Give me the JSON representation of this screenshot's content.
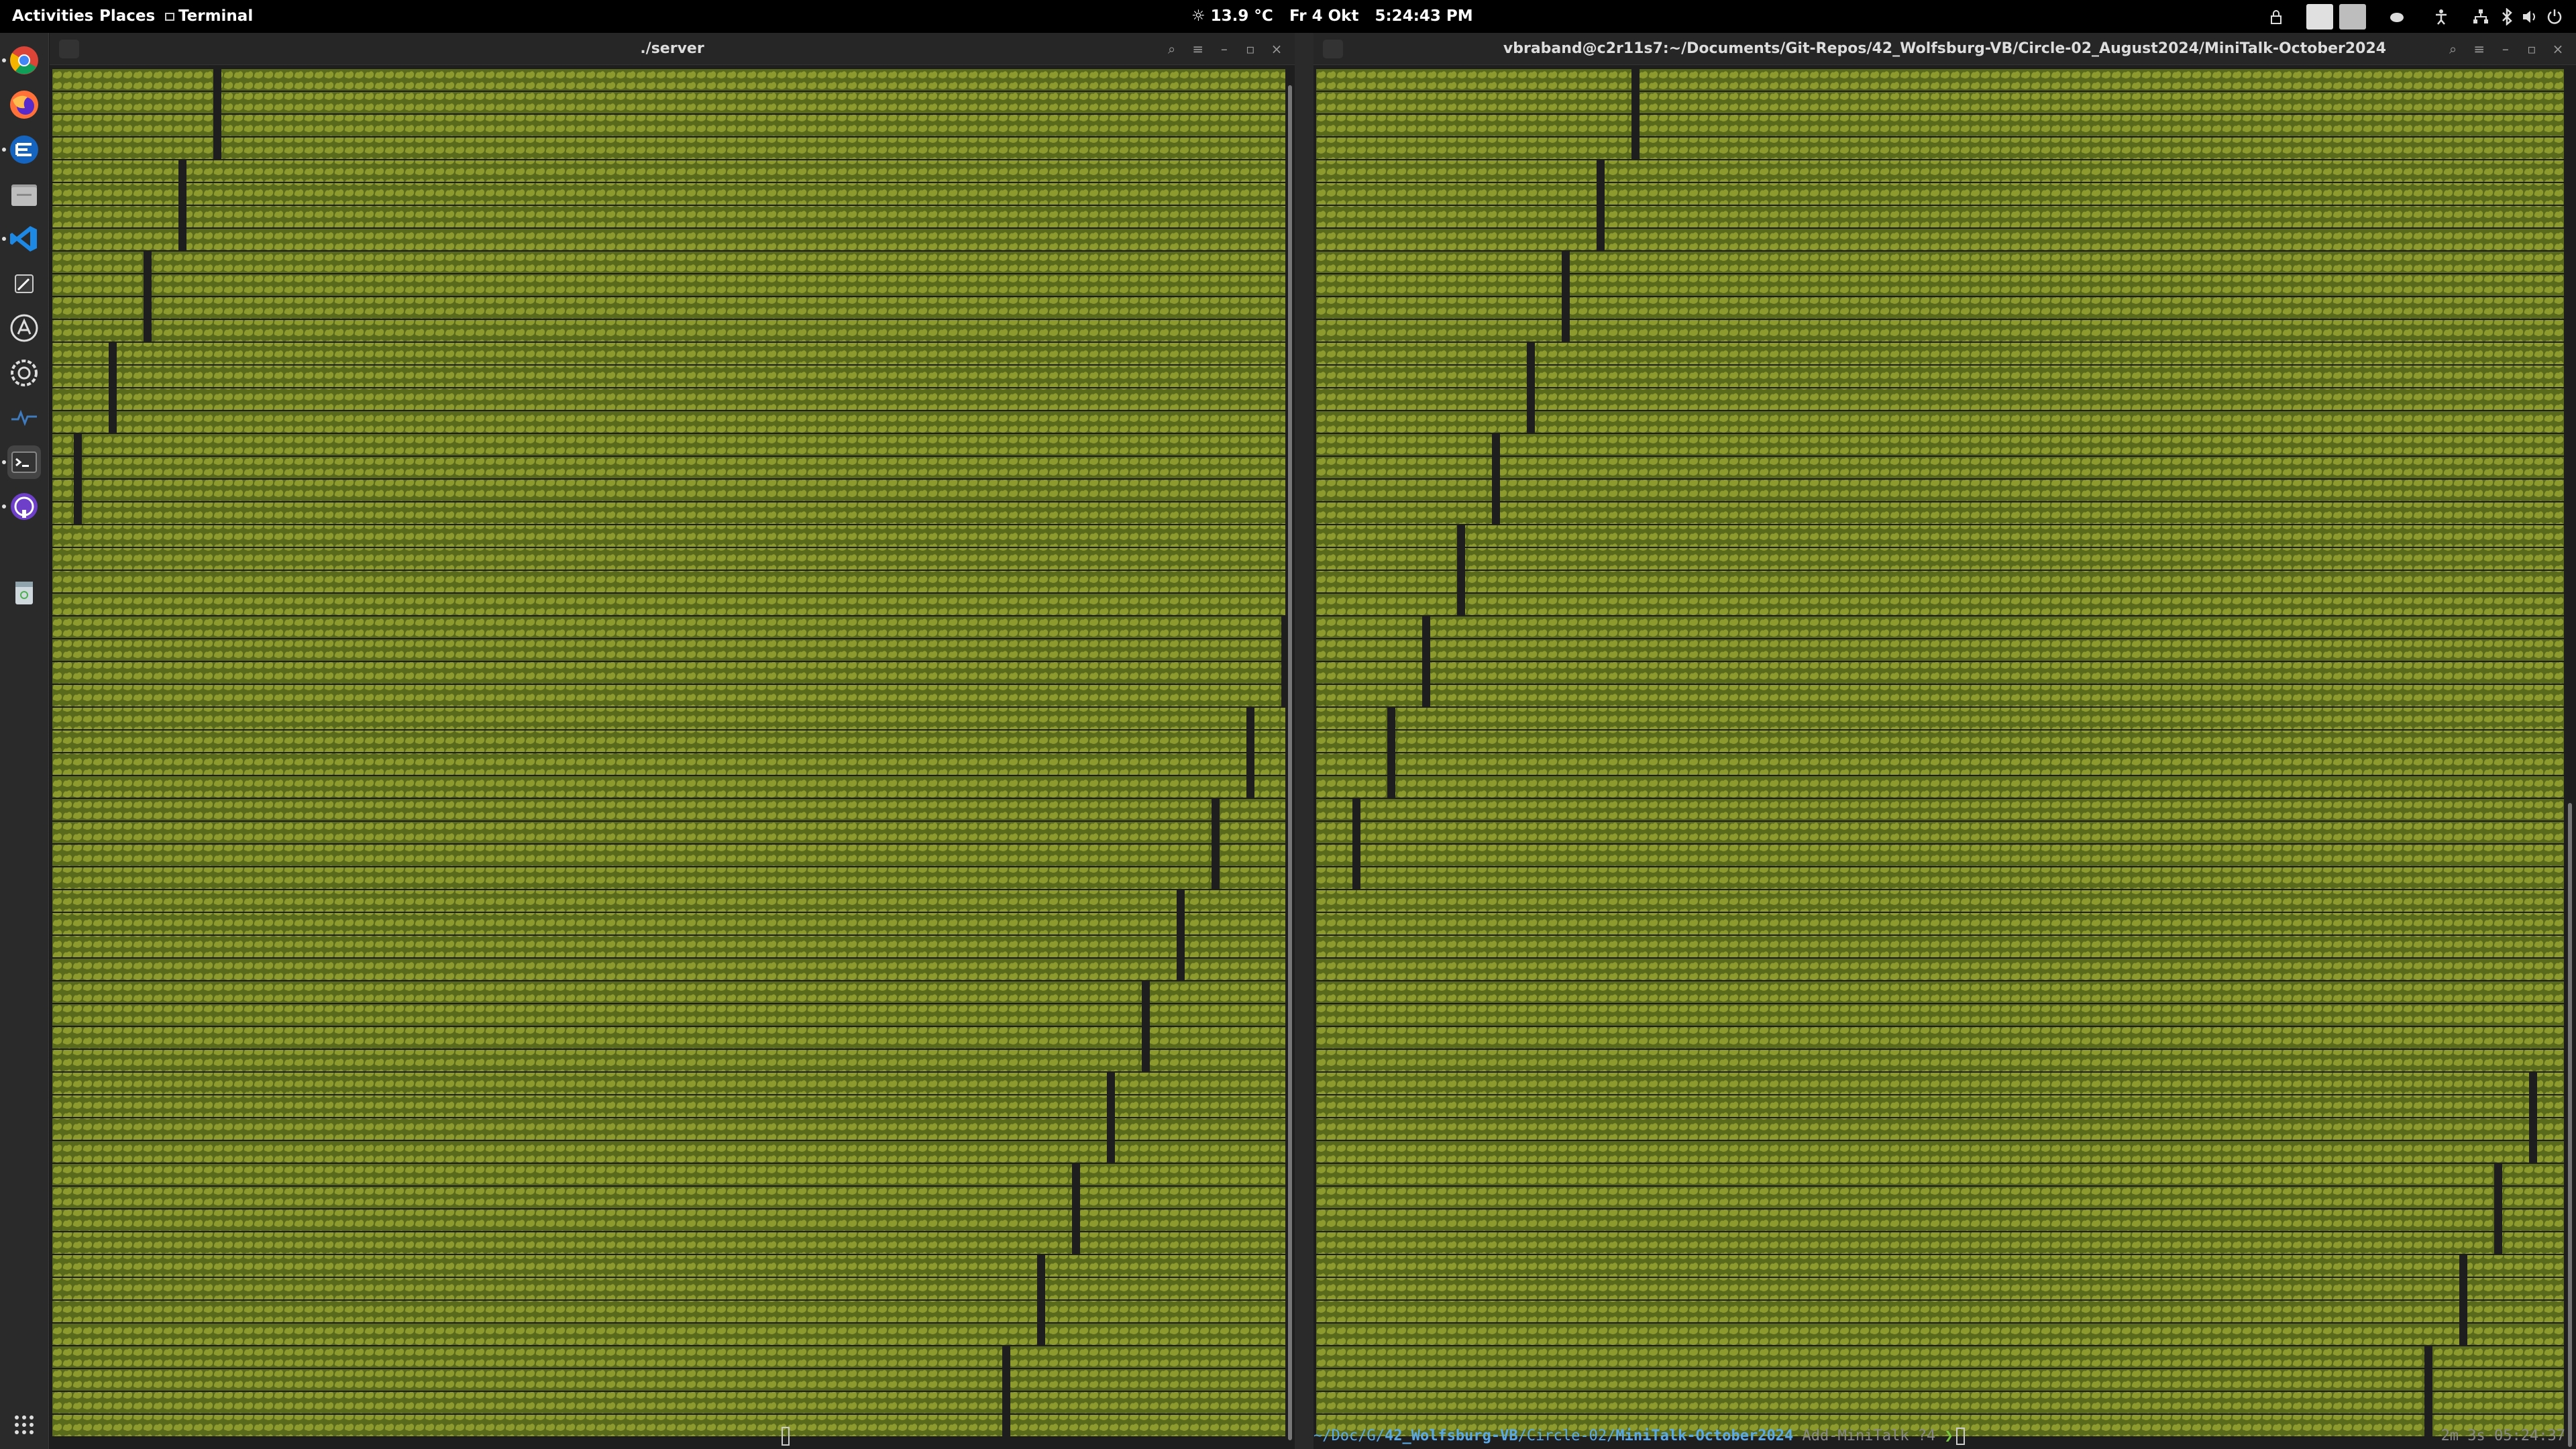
{
  "topbar": {
    "activities": "Activities",
    "places": "Places",
    "app": "Terminal",
    "weather": "13.9 °C",
    "date": "Fr 4 Okt",
    "time": "5:24:43 PM"
  },
  "dock": {
    "items": [
      "chrome-icon",
      "firefox-icon",
      "cursor-editor-icon",
      "files-icon",
      "vscode-icon",
      "text-editor-icon",
      "app-center-icon",
      "settings-icon",
      "system-monitor-icon",
      "terminal-icon",
      "github-desktop-icon",
      "trash-icon",
      "show-apps-icon"
    ]
  },
  "left_window": {
    "title": "./server"
  },
  "right_window": {
    "title": "vbraband@c2r11s7:~/Documents/Git-Repos/42_Wolfsburg-VB/Circle-02_August2024/MiniTalk-October2024"
  },
  "prompt": {
    "path_prefix": "~/Doc/G/",
    "repo": "42_Wolfsburg-VB",
    "mid": "/Circle-02/",
    "dir": "MiniTalk-October2024",
    "branch": "Add-MiniTalk",
    "status": "?4",
    "arrow": "❯"
  },
  "status_right": "2m 3s 05:24:37",
  "colors": {
    "tile": "#8c9a2e",
    "tile_dark": "#5a6a1c",
    "background": "#1e1e1e",
    "prompt_blue": "#5aa9e6",
    "prompt_green": "#7ac943"
  }
}
